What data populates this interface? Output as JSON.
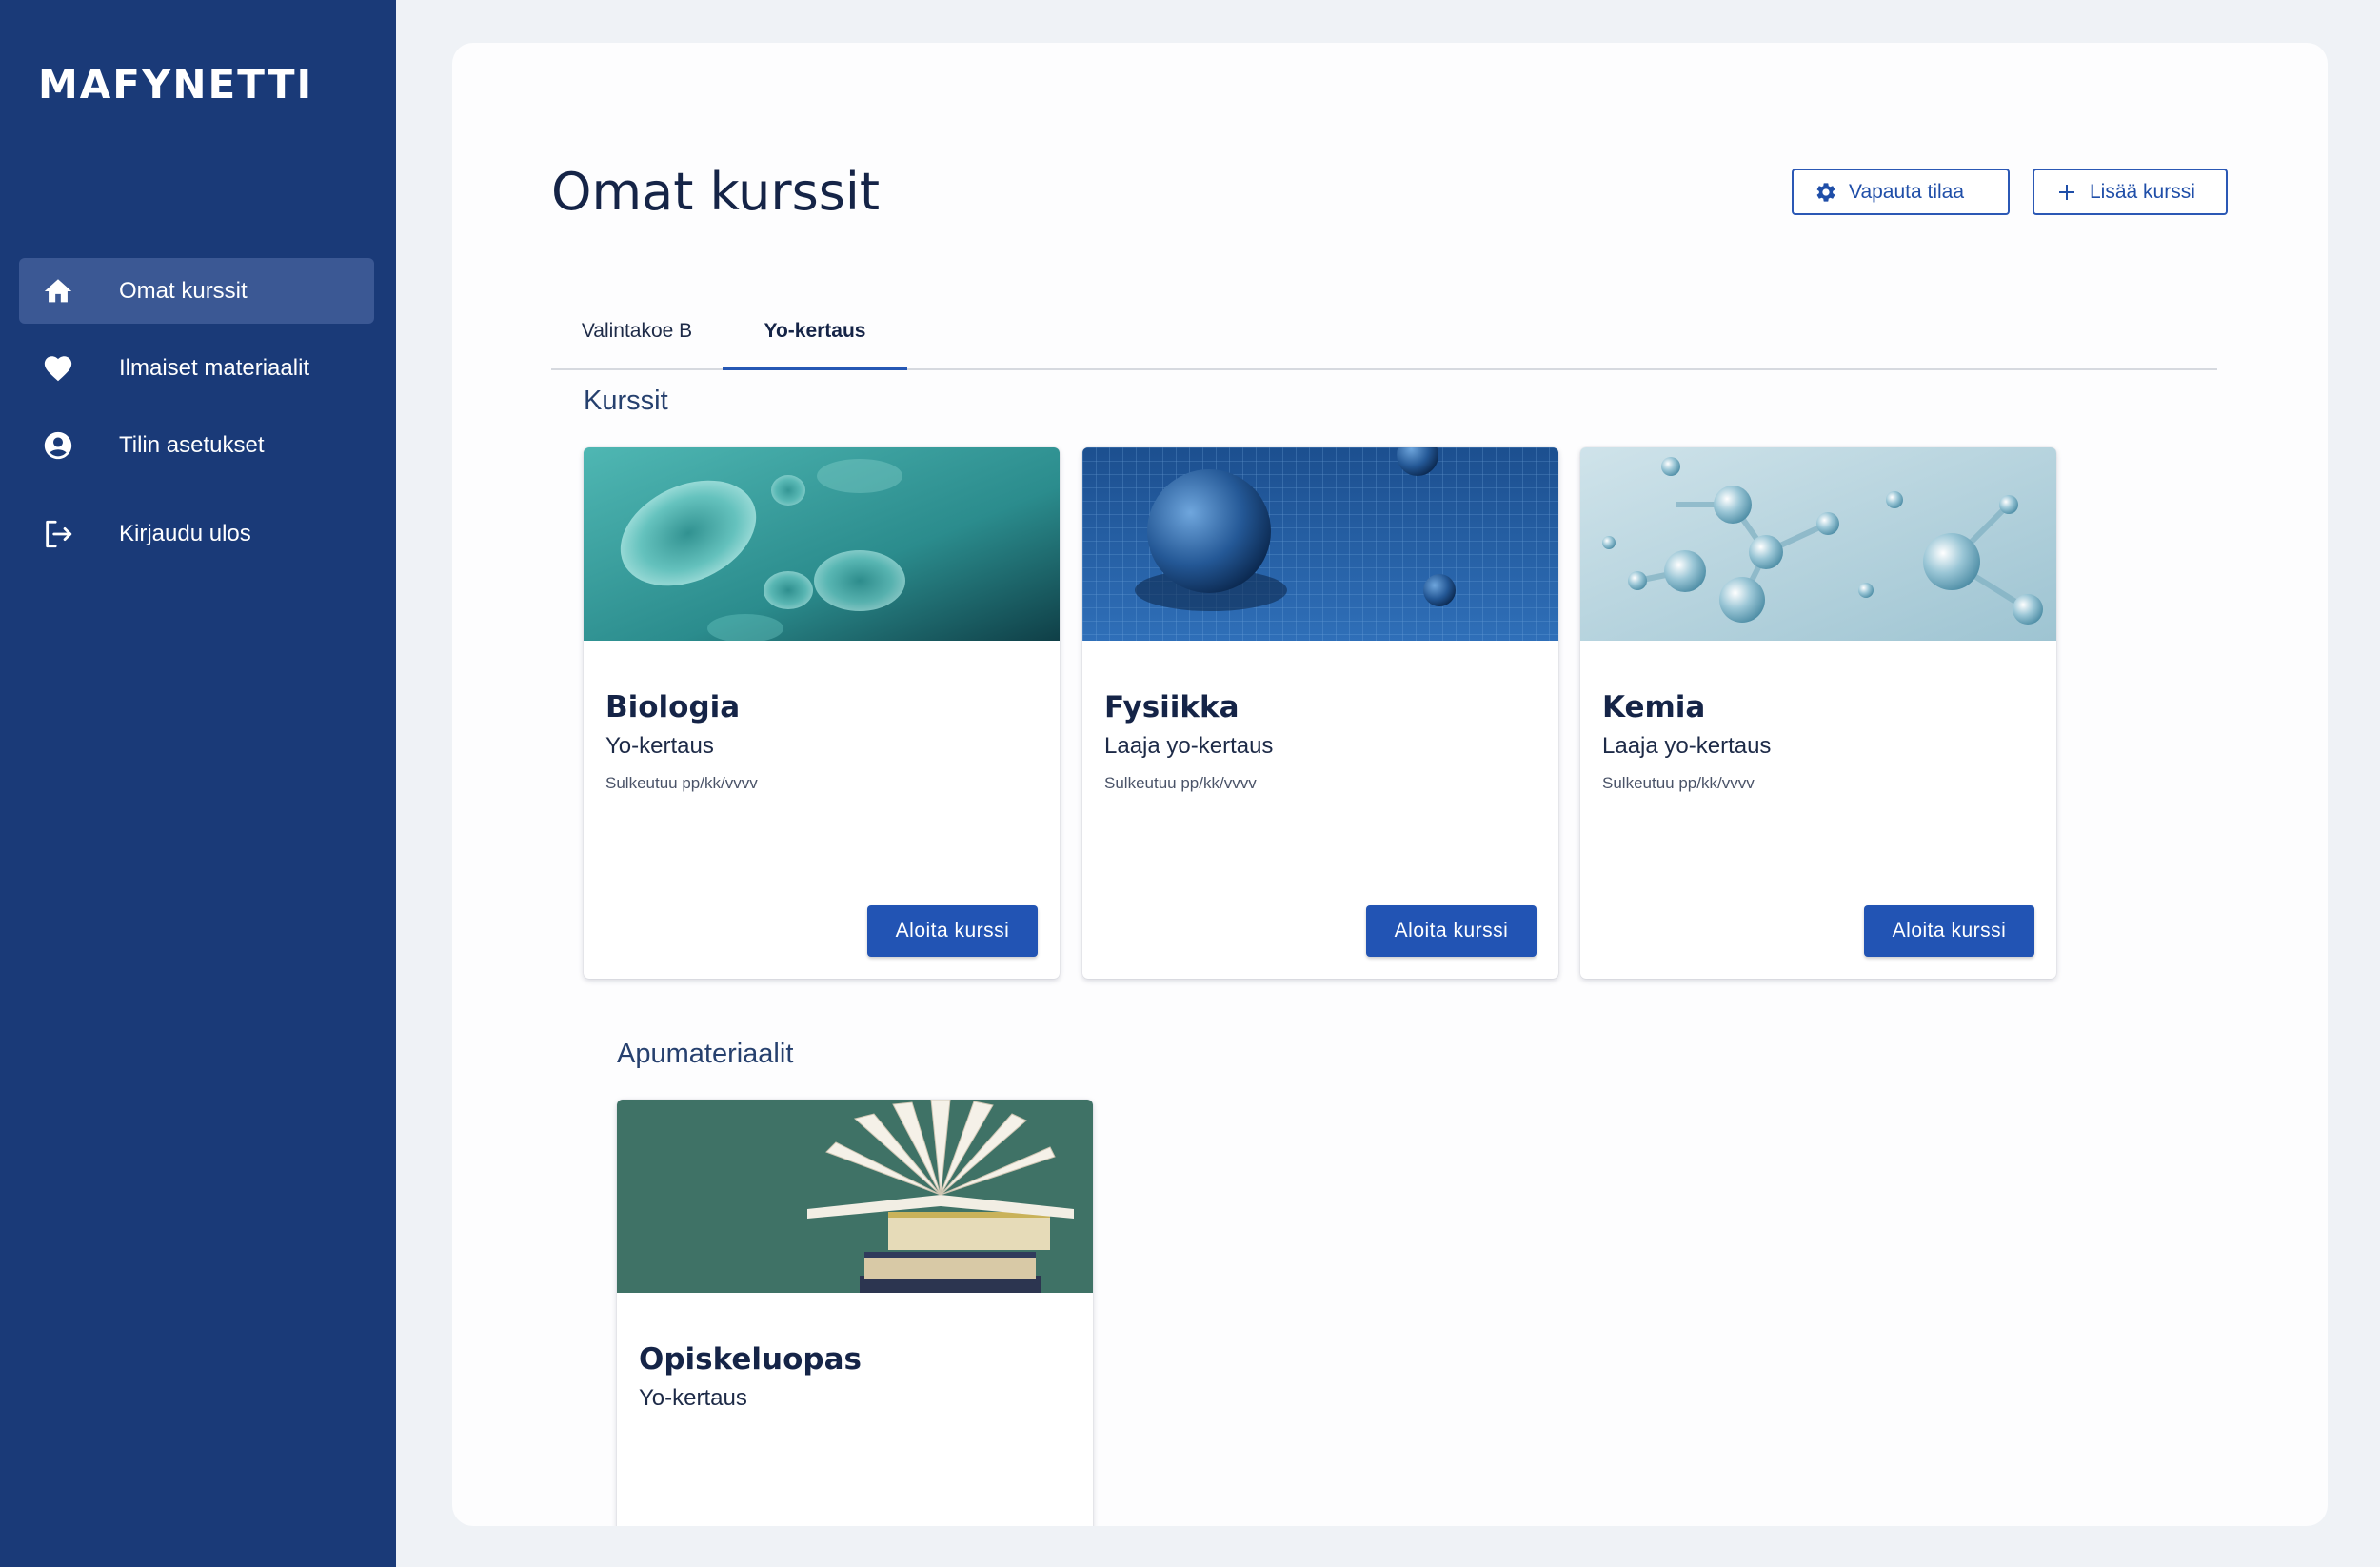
{
  "brand": "MAFYNETTI",
  "sidebar": {
    "items": [
      {
        "label": "Omat kurssit",
        "icon": "home-icon"
      },
      {
        "label": "Ilmaiset materiaalit",
        "icon": "heart-icon"
      },
      {
        "label": "Tilin asetukset",
        "icon": "account-circle-icon"
      },
      {
        "label": "Kirjaudu ulos",
        "icon": "logout-icon"
      }
    ]
  },
  "main": {
    "title": "Omat kurssit",
    "actions": {
      "free_space": "Vapauta tilaa",
      "add_course": "Lisää kurssi"
    },
    "tabs": [
      {
        "label": "Valintakoe B"
      },
      {
        "label": "Yo-kertaus"
      }
    ],
    "courses_heading": "Kurssit",
    "courses": [
      {
        "title": "Biologia",
        "subtitle": "Yo-kertaus",
        "closes": "Sulkeutuu pp/kk/vvvv",
        "button": "Aloita kurssi"
      },
      {
        "title": "Fysiikka",
        "subtitle": "Laaja yo-kertaus",
        "closes": "Sulkeutuu pp/kk/vvvv",
        "button": "Aloita kurssi"
      },
      {
        "title": "Kemia",
        "subtitle": "Laaja yo-kertaus",
        "closes": "Sulkeutuu pp/kk/vvvv",
        "button": "Aloita kurssi"
      }
    ],
    "materials_heading": "Apumateriaalit",
    "materials": [
      {
        "title": "Opiskeluopas",
        "subtitle": "Yo-kertaus"
      }
    ]
  },
  "colors": {
    "sidebar": "#1a3a78",
    "sidebar_active": "#3b5894",
    "primary": "#2254b4",
    "page_bg": "#eff2f6"
  }
}
